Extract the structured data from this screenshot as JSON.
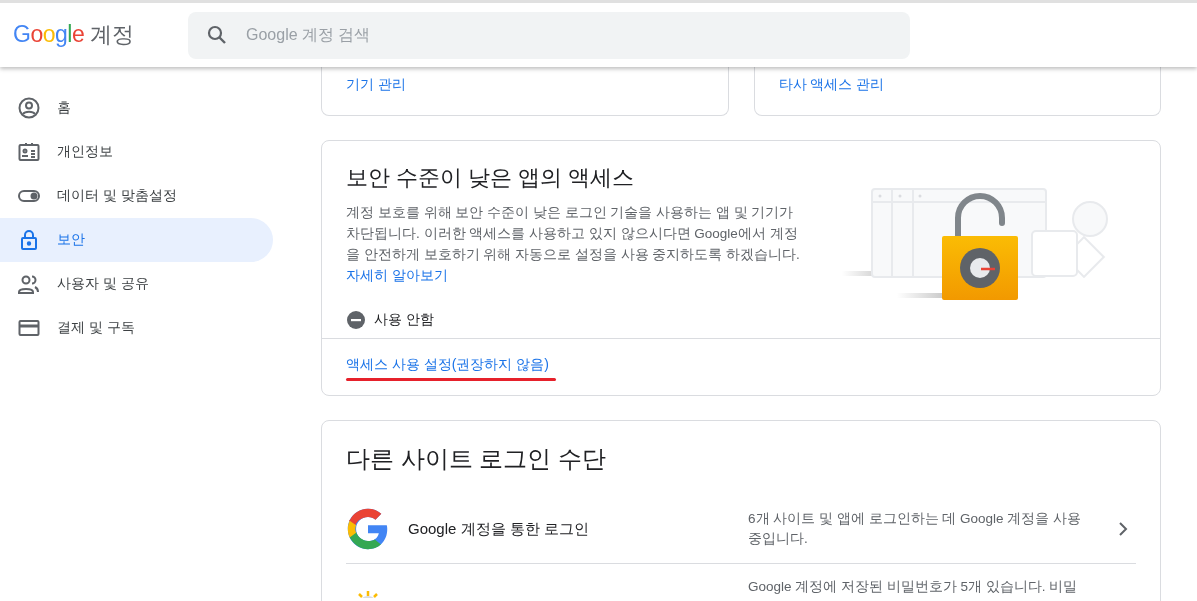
{
  "header": {
    "logo": "Google",
    "product": "계정",
    "search": {
      "placeholder": "Google 계정 검색"
    }
  },
  "sidebar": {
    "items": [
      {
        "label": "홈",
        "selected": false
      },
      {
        "label": "개인정보",
        "selected": false
      },
      {
        "label": "데이터 및 맞춤설정",
        "selected": false
      },
      {
        "label": "보안",
        "selected": true
      },
      {
        "label": "사용자 및 공유",
        "selected": false
      },
      {
        "label": "결제 및 구독",
        "selected": false
      }
    ]
  },
  "top_links": [
    "기기 관리",
    "타사 액세스 관리"
  ],
  "less_secure": {
    "title": "보안 수준이 낮은 앱의 액세스",
    "description": "계정 보호를 위해 보안 수준이 낮은 로그인 기술을 사용하는 앱 및 기기가 차단됩니다. 이러한 액세스를 사용하고 있지 않으시다면 Google에서 계정을 안전하게 보호하기 위해 자동으로 설정을 사용 중지하도록 하겠습니다.",
    "learn_more": "자세히 알아보기",
    "status": {
      "on": false,
      "label": "사용 안함"
    },
    "action": "액세스 사용 설정(권장하지 않음)"
  },
  "other_signin": {
    "title": "다른 사이트 로그인 수단",
    "rows": [
      {
        "kind": "google",
        "title": "Google 계정을 통한 로그인",
        "description": "6개 사이트 및 앱에 로그인하는 데 Google 계정을 사용 중입니다."
      },
      {
        "kind": "key",
        "description": "Google 계정에 저장된 비밀번호가 5개 있습니다. 비밀"
      }
    ]
  }
}
